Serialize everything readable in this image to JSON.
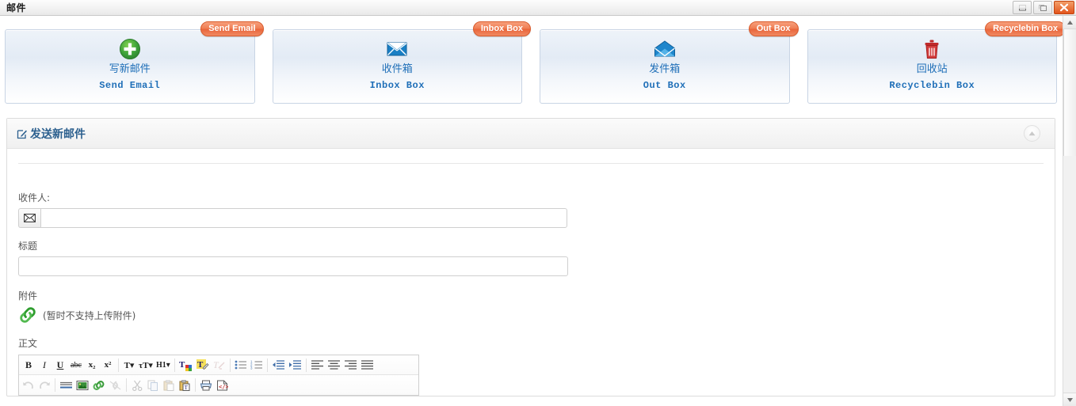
{
  "window": {
    "title": "邮件",
    "controls": [
      {
        "name": "minimize",
        "label": "–"
      },
      {
        "name": "maximize",
        "label": "❐"
      },
      {
        "name": "close",
        "label": "✕"
      }
    ]
  },
  "nav": {
    "cards": [
      {
        "icon": "plus-circle-icon",
        "cn": "写新邮件",
        "en": "Send Email",
        "badge": "Send Email"
      },
      {
        "icon": "envelope-closed-icon",
        "cn": "收件箱",
        "en": "Inbox Box",
        "badge": "Inbox Box"
      },
      {
        "icon": "envelope-open-icon",
        "cn": "发件箱",
        "en": "Out Box",
        "badge": "Out Box"
      },
      {
        "icon": "trash-icon",
        "cn": "回收站",
        "en": "Recyclebin Box",
        "badge": "Recyclebin Box"
      }
    ]
  },
  "panel": {
    "title": "发送新邮件",
    "collapse_icon": "chevron-up-icon"
  },
  "form": {
    "recipient_label": "收件人:",
    "recipient_value": "",
    "recipient_placeholder": "",
    "recipient_addon_icon": "envelope-icon",
    "subject_label": "标题",
    "subject_value": "",
    "subject_placeholder": "",
    "attachment_label": "附件",
    "attachment_icon": "link-chain-icon",
    "attachment_note": "(暂时不支持上传附件)",
    "body_label": "正文"
  },
  "editor": {
    "row1": [
      {
        "name": "bold-button",
        "label": "B"
      },
      {
        "name": "italic-button",
        "label": "I"
      },
      {
        "name": "underline-button",
        "label": "U"
      },
      {
        "name": "strikethrough-button",
        "label": "abc"
      },
      {
        "name": "subscript-button",
        "label": "x₂"
      },
      {
        "name": "superscript-button",
        "label": "x²"
      },
      {
        "name": "font-name-button",
        "label": "T▾"
      },
      {
        "name": "font-size-button",
        "label": "τT▾"
      },
      {
        "name": "heading-button",
        "label": "H1▾"
      },
      {
        "name": "text-color-button",
        "label": ""
      },
      {
        "name": "highlight-color-button",
        "label": ""
      },
      {
        "name": "remove-format-button",
        "label": ""
      },
      {
        "name": "bullet-list-button",
        "label": ""
      },
      {
        "name": "numbered-list-button",
        "label": ""
      },
      {
        "name": "outdent-button",
        "label": ""
      },
      {
        "name": "indent-button",
        "label": ""
      },
      {
        "name": "align-left-button",
        "label": ""
      },
      {
        "name": "align-center-button",
        "label": ""
      },
      {
        "name": "align-right-button",
        "label": ""
      },
      {
        "name": "align-justify-button",
        "label": ""
      }
    ],
    "row2": [
      {
        "name": "undo-button",
        "label": ""
      },
      {
        "name": "redo-button",
        "label": ""
      },
      {
        "name": "horizontal-rule-button",
        "label": ""
      },
      {
        "name": "insert-image-button",
        "label": ""
      },
      {
        "name": "insert-link-button",
        "label": ""
      },
      {
        "name": "unlink-button",
        "label": ""
      },
      {
        "name": "cut-button",
        "label": ""
      },
      {
        "name": "copy-button",
        "label": ""
      },
      {
        "name": "paste-button",
        "label": ""
      },
      {
        "name": "paste-text-button",
        "label": ""
      },
      {
        "name": "print-button",
        "label": ""
      },
      {
        "name": "source-code-button",
        "label": ""
      }
    ]
  },
  "colors": {
    "badge": "#ef7d52",
    "link_blue": "#1f6fb8",
    "panel_title": "#2b5f8e",
    "green": "#3a9d3a",
    "red": "#c42d2d",
    "close_btn": "#e2541c"
  }
}
